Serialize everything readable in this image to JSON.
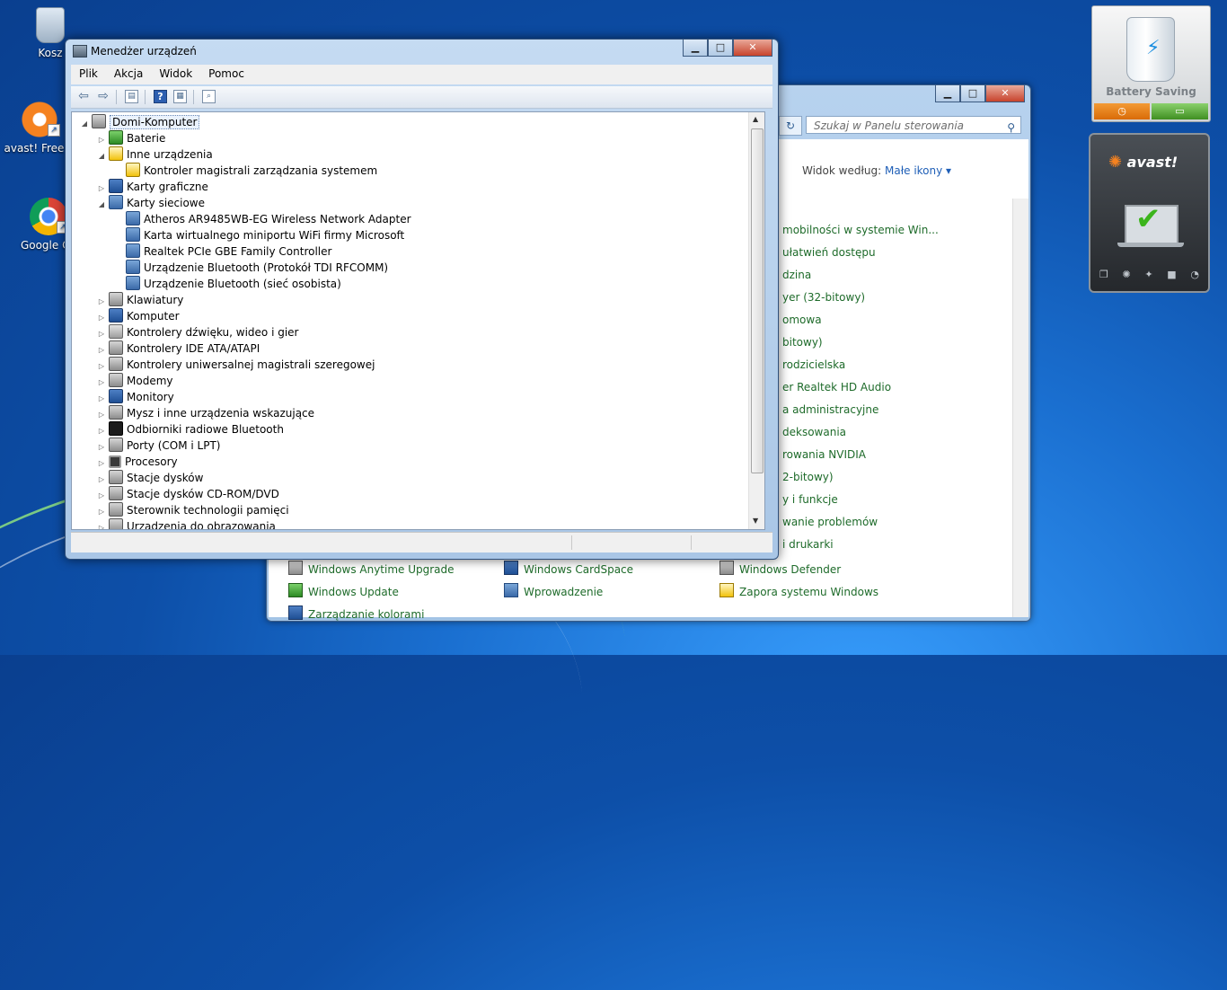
{
  "desktop": {
    "icons": [
      {
        "label": "Kosz"
      },
      {
        "label": "avast! Free A"
      },
      {
        "label": "Google Ch"
      }
    ]
  },
  "control_panel": {
    "search_placeholder": "Szukaj w Panelu sterowania",
    "view_by_label": "Widok według:",
    "view_by_value": "Małe ikony ▾",
    "items": [
      "mobilności w systemie Win...",
      "ułatwień dostępu",
      "dzina",
      "yer (32-bitowy)",
      "omowa",
      "bitowy)",
      "rodzicielska",
      "er Realtek HD Audio",
      "a administracyjne",
      "deksowania",
      "rowania NVIDIA",
      "2-bitowy)",
      "y i funkcje",
      "wanie problemów",
      "i drukarki"
    ],
    "bottom_items": [
      "Windows Anytime Upgrade",
      "Windows CardSpace",
      "Windows Defender",
      "Windows Update",
      "Wprowadzenie",
      "Zapora systemu Windows",
      "Zarządzanie kolorami"
    ]
  },
  "device_manager": {
    "title": "Menedżer urządzeń",
    "menu": [
      "Plik",
      "Akcja",
      "Widok",
      "Pomoc"
    ],
    "tree": {
      "root": "Domi-Komputer",
      "nodes": [
        "Baterie",
        "Inne urządzenia",
        "Kontroler magistrali zarządzania systemem",
        "Karty graficzne",
        "Karty sieciowe",
        "Atheros AR9485WB-EG Wireless Network Adapter",
        "Karta wirtualnego miniportu WiFi firmy Microsoft",
        "Realtek PCIe GBE Family Controller",
        "Urządzenie Bluetooth (Protokół TDI RFCOMM)",
        "Urządzenie Bluetooth (sieć osobista)",
        "Klawiatury",
        "Komputer",
        "Kontrolery dźwięku, wideo i gier",
        "Kontrolery IDE ATA/ATAPI",
        "Kontrolery uniwersalnej magistrali szeregowej",
        "Modemy",
        "Monitory",
        "Mysz i inne urządzenia wskazujące",
        "Odbiorniki radiowe Bluetooth",
        "Porty (COM i LPT)",
        "Procesory",
        "Stacje dysków",
        "Stacje dysków CD-ROM/DVD",
        "Sterownik technologii pamięci",
        "Urządzenia do obrazowania"
      ]
    }
  },
  "gadgets": {
    "battery_label": "Battery Saving",
    "avast_label": "avast!"
  },
  "colors": {
    "link_green": "#1e6b2a",
    "accent_blue": "#1f5fb7",
    "avast_orange": "#f58220"
  }
}
